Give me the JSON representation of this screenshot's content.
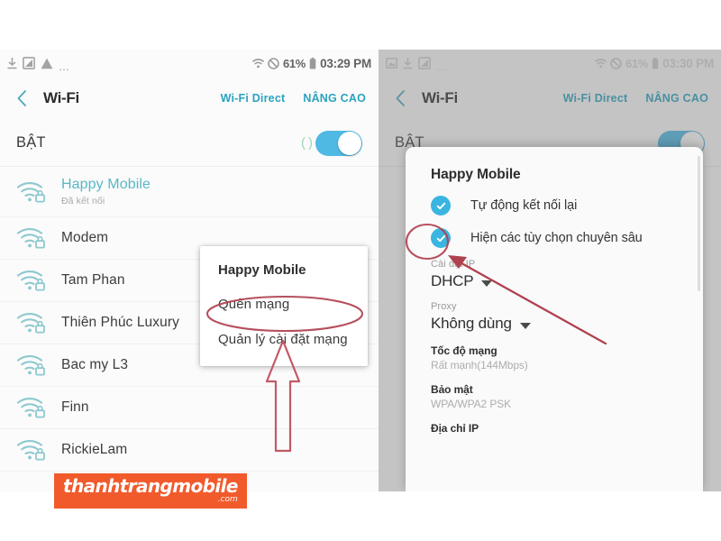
{
  "meta": {
    "accent_teal": "#2aa3bf",
    "accent_blue": "#4fb9e3",
    "annotation_red": "#b03a4a",
    "watermark_orange": "#f15a2b"
  },
  "left_panel": {
    "statusbar": {
      "icons": [
        "download-icon",
        "screenshot-icon",
        "warning-icon"
      ],
      "overflow": "…",
      "wifi_icon": "wifi-status-icon",
      "mute_icon": "no-sound-icon",
      "battery_percent": "61%",
      "battery_icon": "battery-icon",
      "clock": "03:29 PM"
    },
    "actionbar": {
      "back": "back-chevron-icon",
      "title": "Wi-Fi",
      "action_direct": "Wi-Fi Direct",
      "action_advanced": "NÂNG CAO"
    },
    "toggle": {
      "label": "BẬT",
      "state": "on"
    },
    "networks": [
      {
        "name": "Happy Mobile",
        "sub": "Đã kết nối",
        "connected": true
      },
      {
        "name": "Modem",
        "sub": "",
        "connected": false
      },
      {
        "name": "Tam Phan",
        "sub": "",
        "connected": false
      },
      {
        "name": "Thiên Phúc Luxury",
        "sub": "",
        "connected": false
      },
      {
        "name": "Bac my L3",
        "sub": "",
        "connected": false
      },
      {
        "name": "Finn",
        "sub": "",
        "connected": false
      },
      {
        "name": "RickieLam",
        "sub": "",
        "connected": false
      }
    ],
    "popup": {
      "title": "Happy Mobile",
      "items": [
        "Quên mạng",
        "Quản lý cài đặt mạng"
      ]
    }
  },
  "right_panel": {
    "statusbar": {
      "icons": [
        "screenshot-icon",
        "download-icon",
        "image-icon"
      ],
      "overflow": "…",
      "wifi_icon": "wifi-status-icon",
      "mute_icon": "no-sound-icon",
      "battery_percent": "61%",
      "battery_icon": "battery-icon",
      "clock": "03:30 PM"
    },
    "actionbar": {
      "back": "back-chevron-icon",
      "title": "Wi-Fi",
      "action_direct": "Wi-Fi Direct",
      "action_advanced": "NÂNG CAO"
    },
    "toggle": {
      "label": "BẬT",
      "state": "on"
    },
    "dialog": {
      "title": "Happy Mobile",
      "checkboxes": [
        {
          "label": "Tự động kết nối lại",
          "checked": true
        },
        {
          "label": "Hiện các tùy chọn chuyên sâu",
          "checked": true
        }
      ],
      "fields": [
        {
          "label": "Cài đặt IP",
          "value": "DHCP"
        },
        {
          "label": "Proxy",
          "value": "Không dùng"
        }
      ],
      "info": [
        {
          "label": "Tốc độ mạng",
          "value": "Rất mạnh(144Mbps)"
        },
        {
          "label": "Bảo mật",
          "value": "WPA/WPA2 PSK"
        },
        {
          "label": "Địa chỉ IP",
          "value": ""
        }
      ]
    }
  },
  "annotations": {
    "left_ellipse_target": "Quản lý cài đặt mạng",
    "left_arrow": "up-arrow-annotation",
    "right_ellipse_target": "Hiện các tùy chọn chuyên sâu checkbox",
    "right_arrow": "diagonal-arrow-annotation"
  },
  "watermark": {
    "main": "thanhtrangmobile",
    "sub": ".com"
  }
}
